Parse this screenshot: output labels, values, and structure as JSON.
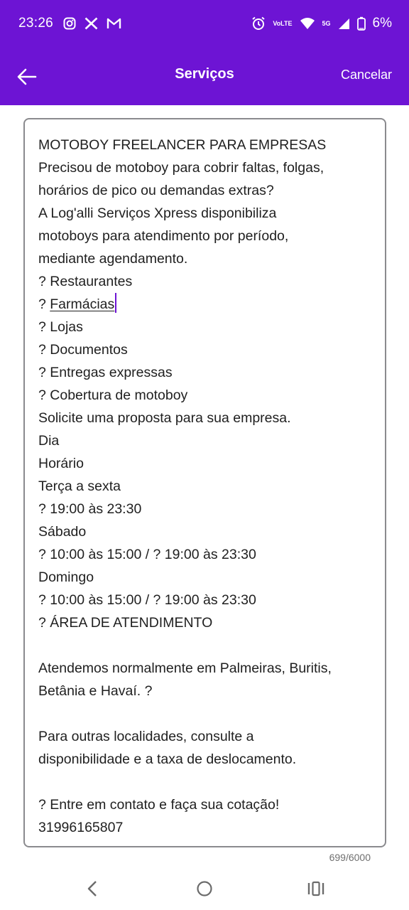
{
  "status_bar": {
    "time": "23:26",
    "notification_icons": [
      "instagram-icon",
      "x-icon",
      "gmail-icon"
    ],
    "system_icons": [
      "alarm-icon",
      "volte-icon",
      "wifi-icon",
      "5g-signal-icon",
      "battery-icon"
    ],
    "volte_label": "VoLTE",
    "network_label": "5G",
    "battery": "6%"
  },
  "app_bar": {
    "title": "Serviços",
    "cancel_label": "Cancelar",
    "background_color": "#6d14d4"
  },
  "editor": {
    "lines": [
      "MOTOBOY FREELANCER PARA EMPRESAS",
      "Precisou de motoboy para cobrir faltas, folgas,",
      "horários de pico ou demandas extras?",
      "A Log'alli Serviços Xpress disponibiliza",
      "motoboys para atendimento por período,",
      "mediante agendamento.",
      "? Restaurantes",
      "? ",
      "? Lojas",
      "? Documentos",
      "? Entregas expressas",
      "? Cobertura de motoboy",
      "Solicite uma proposta para sua empresa.",
      "Dia",
      "Horário",
      "Terça a sexta",
      "? 19:00 às 23:30",
      "Sábado",
      "? 10:00 às 15:00 / ? 19:00 às 23:30",
      "Domingo",
      "? 10:00 às 15:00 / ? 19:00 às 23:30",
      "? ÁREA DE ATENDIMENTO",
      "",
      "Atendemos normalmente em Palmeiras, Buritis,",
      "Betânia e Havaí. ?",
      "",
      "Para outras localidades, consulte a",
      "disponibilidade e a taxa de deslocamento.",
      "",
      "? Entre em contato e faça sua cotação!",
      "31996165807"
    ],
    "underlined_word": "Farmácias",
    "character_count": "699/6000"
  },
  "nav_bar": {
    "buttons": [
      "back-nav-icon",
      "home-nav-icon",
      "recents-nav-icon"
    ]
  }
}
